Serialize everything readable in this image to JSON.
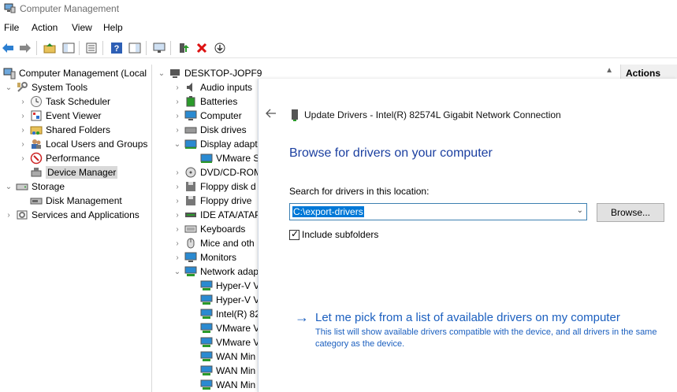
{
  "window": {
    "title": "Computer Management"
  },
  "menu": {
    "file": "File",
    "action": "Action",
    "view": "View",
    "help": "Help"
  },
  "left_tree": {
    "root": "Computer Management (Local",
    "system_tools": "System Tools",
    "task_scheduler": "Task Scheduler",
    "event_viewer": "Event Viewer",
    "shared_folders": "Shared Folders",
    "local_users": "Local Users and Groups",
    "performance": "Performance",
    "device_manager": "Device Manager",
    "storage": "Storage",
    "disk_management": "Disk Management",
    "services": "Services and Applications"
  },
  "device_tree": {
    "root": "DESKTOP-JOPF9",
    "items": [
      "Audio inputs",
      "Batteries",
      "Computer",
      "Disk drives",
      "Display adapt",
      "VMware S",
      "DVD/CD-ROM",
      "Floppy disk d",
      "Floppy drive",
      "IDE ATA/ATAP",
      "Keyboards",
      "Mice and oth",
      "Monitors",
      "Network adap",
      "Hyper-V V",
      "Hyper-V V",
      "Intel(R) 82",
      "VMware V",
      "VMware V",
      "WAN Min",
      "WAN Min",
      "WAN Min"
    ]
  },
  "actions": {
    "header": "Actions"
  },
  "dialog": {
    "title": "Update Drivers - Intel(R) 82574L Gigabit Network Connection",
    "heading": "Browse for drivers on your computer",
    "search_label": "Search for drivers in this location:",
    "path_value": "C:\\export-drivers",
    "browse_button": "Browse...",
    "include_subfolders": "Include subfolders",
    "pick_link": "Let me pick from a list of available drivers on my computer",
    "pick_desc": "This list will show available drivers compatible with the device, and all drivers in the same category as the device."
  },
  "colors": {
    "link": "#1b5fbf",
    "heading": "#1b3fa0",
    "selection": "#0078d7"
  }
}
